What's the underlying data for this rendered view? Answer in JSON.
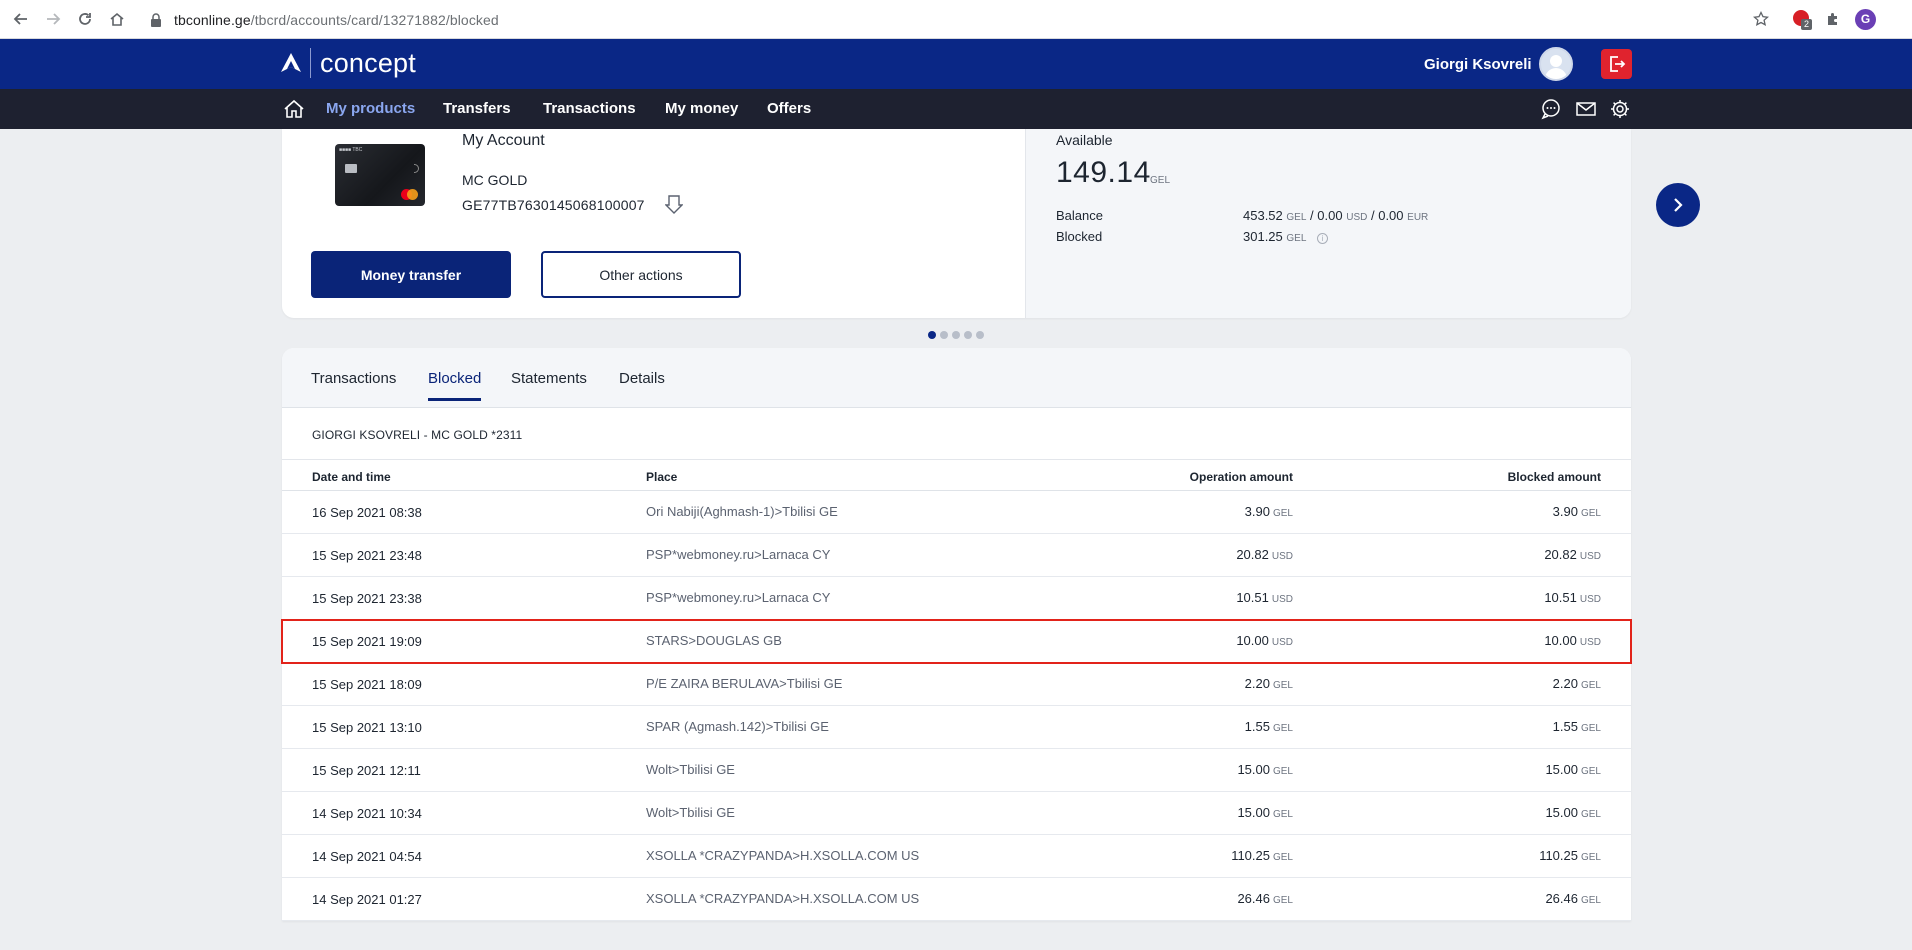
{
  "browser": {
    "url_host": "tbconline.ge",
    "url_path": "/tbcrd/accounts/card/13271882/blocked",
    "extension_badge": "2",
    "profile_initial": "G"
  },
  "header": {
    "logo_text": "concept",
    "user_name": "Giorgi Ksovreli"
  },
  "nav": {
    "items": [
      {
        "label": "My products",
        "active": true
      },
      {
        "label": "Transfers"
      },
      {
        "label": "Transactions"
      },
      {
        "label": "My money"
      },
      {
        "label": "Offers"
      }
    ]
  },
  "account": {
    "title": "My Account",
    "product": "MC GOLD",
    "iban": "GE77TB7630145068100007",
    "money_transfer_label": "Money transfer",
    "other_actions_label": "Other actions",
    "available_label": "Available",
    "available_amount": "149.14",
    "available_currency": "GEL",
    "balance_label": "Balance",
    "balance": {
      "gel": "453.52",
      "gel_cur": "GEL",
      "sep1": "/",
      "usd": "0.00",
      "usd_cur": "USD",
      "sep2": "/",
      "eur": "0.00",
      "eur_cur": "EUR"
    },
    "blocked_label": "Blocked",
    "blocked_amount": "301.25",
    "blocked_currency": "GEL",
    "info_glyph": "i"
  },
  "carousel": {
    "count": 5,
    "active_index": 0
  },
  "tabs": {
    "transactions": "Transactions",
    "blocked": "Blocked",
    "statements": "Statements",
    "details": "Details"
  },
  "table": {
    "caption": "GIORGI KSOVRELI - MC GOLD *2311",
    "headers": {
      "date": "Date and time",
      "place": "Place",
      "operation_amount": "Operation amount",
      "blocked_amount": "Blocked amount"
    },
    "rows": [
      {
        "date": "16 Sep 2021 08:38",
        "place": "Ori Nabiji(Aghmash-1)>Tbilisi GE",
        "op": "3.90",
        "op_cur": "GEL",
        "bl": "3.90",
        "bl_cur": "GEL",
        "highlighted": false
      },
      {
        "date": "15 Sep 2021 23:48",
        "place": "PSP*webmoney.ru>Larnaca CY",
        "op": "20.82",
        "op_cur": "USD",
        "bl": "20.82",
        "bl_cur": "USD",
        "highlighted": false
      },
      {
        "date": "15 Sep 2021 23:38",
        "place": "PSP*webmoney.ru>Larnaca CY",
        "op": "10.51",
        "op_cur": "USD",
        "bl": "10.51",
        "bl_cur": "USD",
        "highlighted": false
      },
      {
        "date": "15 Sep 2021 19:09",
        "place": "STARS>DOUGLAS GB",
        "op": "10.00",
        "op_cur": "USD",
        "bl": "10.00",
        "bl_cur": "USD",
        "highlighted": true
      },
      {
        "date": "15 Sep 2021 18:09",
        "place": "P/E ZAIRA BERULAVA>Tbilisi GE",
        "op": "2.20",
        "op_cur": "GEL",
        "bl": "2.20",
        "bl_cur": "GEL",
        "highlighted": false
      },
      {
        "date": "15 Sep 2021 13:10",
        "place": "SPAR (Agmash.142)>Tbilisi GE",
        "op": "1.55",
        "op_cur": "GEL",
        "bl": "1.55",
        "bl_cur": "GEL",
        "highlighted": false
      },
      {
        "date": "15 Sep 2021 12:11",
        "place": "Wolt>Tbilisi GE",
        "op": "15.00",
        "op_cur": "GEL",
        "bl": "15.00",
        "bl_cur": "GEL",
        "highlighted": false
      },
      {
        "date": "14 Sep 2021 10:34",
        "place": "Wolt>Tbilisi GE",
        "op": "15.00",
        "op_cur": "GEL",
        "bl": "15.00",
        "bl_cur": "GEL",
        "highlighted": false
      },
      {
        "date": "14 Sep 2021 04:54",
        "place": "XSOLLA *CRAZYPANDA>H.XSOLLA.COM US",
        "op": "110.25",
        "op_cur": "GEL",
        "bl": "110.25",
        "bl_cur": "GEL",
        "highlighted": false
      },
      {
        "date": "14 Sep 2021 01:27",
        "place": "XSOLLA *CRAZYPANDA>H.XSOLLA.COM US",
        "op": "26.46",
        "op_cur": "GEL",
        "bl": "26.46",
        "bl_cur": "GEL",
        "highlighted": false
      }
    ]
  },
  "colors": {
    "brand_blue": "#0a2786",
    "nav_dark": "#1e2130",
    "logout_red": "#e0232e",
    "highlight_red": "#e2231a"
  },
  "icons": {
    "back": "arrow-left-icon",
    "forward": "arrow-right-icon",
    "reload": "reload-icon",
    "home": "home-icon",
    "lock": "lock-icon",
    "bookmark": "star-icon",
    "extensions": "puzzle-icon",
    "logout": "logout-icon",
    "chat": "chat-icon",
    "mail": "mail-icon",
    "settings": "gear-icon",
    "download": "download-icon",
    "next": "chevron-right-icon",
    "info": "info-icon"
  }
}
